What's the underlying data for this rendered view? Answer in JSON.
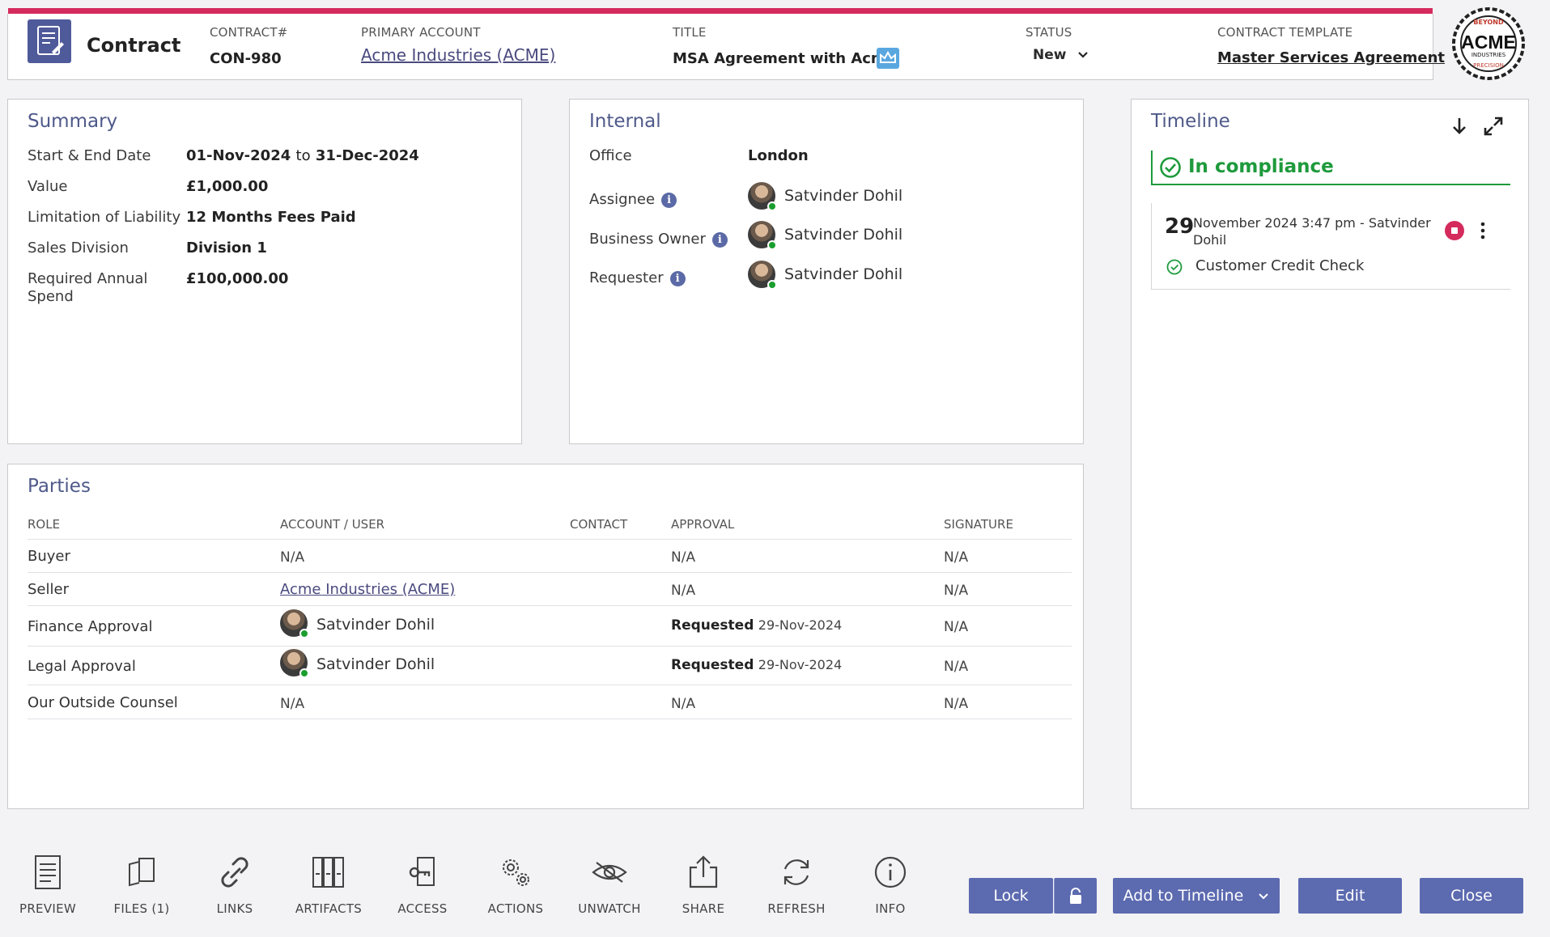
{
  "header": {
    "entity": "Contract",
    "contract_label": "CONTRACT#",
    "contract_value": "CON-980",
    "account_label": "PRIMARY ACCOUNT",
    "account_value": "Acme Industries (ACME)",
    "title_label": "TITLE",
    "title_value": "MSA Agreement with Acme",
    "status_label": "STATUS",
    "status_value": "New",
    "template_label": "CONTRACT TEMPLATE",
    "template_value": "Master Services Agreement",
    "logo_text": "ACME",
    "logo_arc_top": "BEYOND",
    "logo_sub": "INDUSTRIES",
    "logo_arc_bottom": "PRECISION"
  },
  "summary": {
    "title": "Summary",
    "rows": [
      {
        "label": "Start & End Date",
        "value_start": "01-Nov-2024",
        "value_sep": "to",
        "value_end": "31-Dec-2024"
      },
      {
        "label": "Value",
        "value": "£1,000.00"
      },
      {
        "label": "Limitation of Liability",
        "value": "12 Months Fees Paid"
      },
      {
        "label": "Sales Division",
        "value": "Division 1"
      },
      {
        "label": "Required Annual Spend",
        "label_line1": "Required Annual",
        "label_line2": "Spend",
        "value": "£100,000.00"
      }
    ]
  },
  "internal": {
    "title": "Internal",
    "office_label": "Office",
    "office_value": "London",
    "people": [
      {
        "label": "Assignee",
        "name": "Satvinder Dohil"
      },
      {
        "label": "Business Owner",
        "name": "Satvinder Dohil"
      },
      {
        "label": "Requester",
        "name": "Satvinder Dohil"
      }
    ],
    "info_glyph": "i"
  },
  "timeline": {
    "title": "Timeline",
    "compliance": "In compliance",
    "entry": {
      "day": "29",
      "text_line1": "November 2024 3:47 pm - Satvinder",
      "text_line2": "Dohil",
      "item": "Customer Credit Check"
    }
  },
  "parties": {
    "title": "Parties",
    "headers": [
      "ROLE",
      "ACCOUNT / USER",
      "CONTACT",
      "APPROVAL",
      "SIGNATURE"
    ],
    "rows": [
      {
        "role": "Buyer",
        "account": "N/A",
        "approval": "N/A",
        "signature": "N/A"
      },
      {
        "role": "Seller",
        "account": "Acme Industries (ACME)",
        "approval": "N/A",
        "signature": "N/A"
      },
      {
        "role": "Finance Approval",
        "account": "Satvinder Dohil",
        "approval_status": "Requested",
        "approval_date": "29-Nov-2024",
        "signature": "N/A"
      },
      {
        "role": "Legal Approval",
        "account": "Satvinder Dohil",
        "approval_status": "Requested",
        "approval_date": "29-Nov-2024",
        "signature": "N/A"
      },
      {
        "role": "Our Outside Counsel",
        "account": "N/A",
        "approval": "N/A",
        "signature": "N/A"
      }
    ]
  },
  "toolbar": [
    {
      "label": "PREVIEW",
      "icon": "document-icon"
    },
    {
      "label": "FILES (1)",
      "icon": "files-icon"
    },
    {
      "label": "LINKS",
      "icon": "link-icon"
    },
    {
      "label": "ARTIFACTS",
      "icon": "binders-icon"
    },
    {
      "label": "ACCESS",
      "icon": "key-icon"
    },
    {
      "label": "ACTIONS",
      "icon": "gears-icon"
    },
    {
      "label": "UNWATCH",
      "icon": "eye-slash-icon"
    },
    {
      "label": "SHARE",
      "icon": "share-icon"
    },
    {
      "label": "REFRESH",
      "icon": "refresh-icon"
    },
    {
      "label": "INFO",
      "icon": "info-icon"
    }
  ],
  "buttons": {
    "lock": "Lock",
    "add_to_timeline": "Add to Timeline",
    "edit": "Edit",
    "close": "Close"
  },
  "colors": {
    "accent": "#d42b5c",
    "primary": "#5c6ab0",
    "success": "#1e9a3c",
    "heading": "#4f5a8a"
  }
}
